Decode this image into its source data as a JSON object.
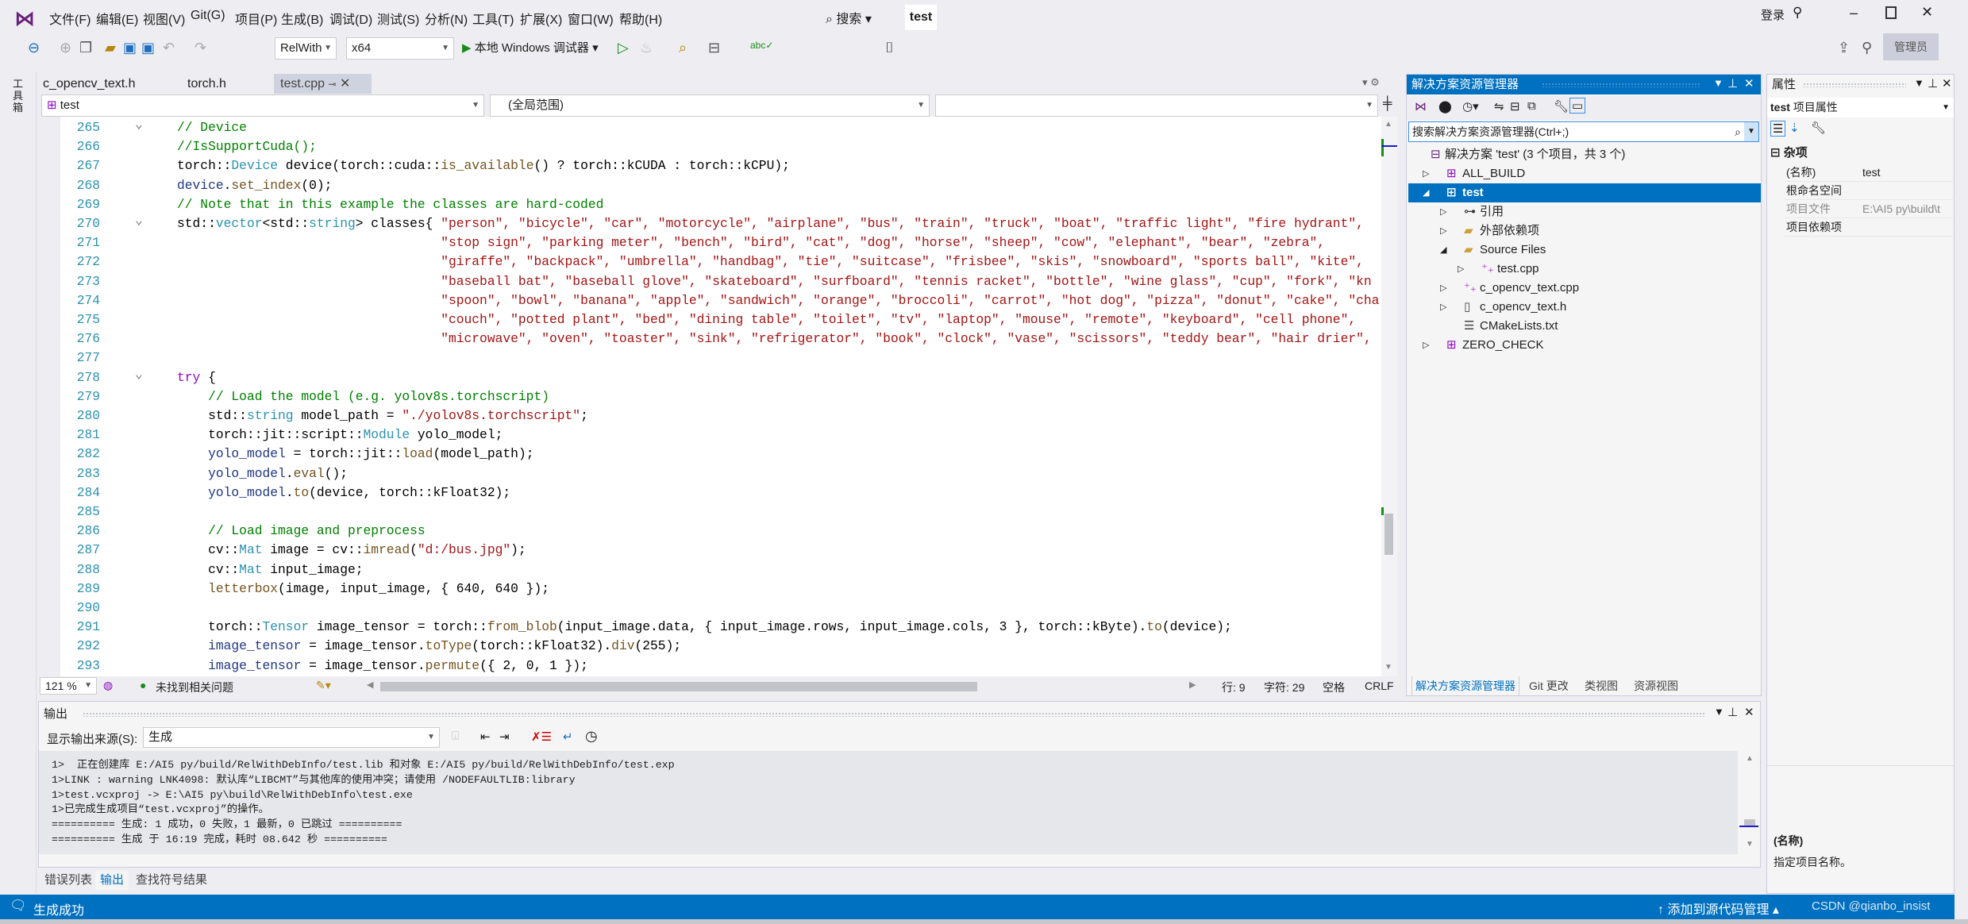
{
  "colors": {
    "accent": "#0070c0",
    "comment": "#008000",
    "type": "#2b91af",
    "string": "#a31515",
    "keyword": "#8f08c4"
  },
  "menubar": {
    "items": [
      "文件(F)",
      "编辑(E)",
      "视图(V)",
      "Git(G)",
      "项目(P)",
      "生成(B)",
      "调试(D)",
      "测试(S)",
      "分析(N)",
      "工具(T)",
      "扩展(X)",
      "窗口(W)",
      "帮助(H)"
    ],
    "search": "搜索",
    "solution_name": "test",
    "login": "登录",
    "admin": "管理员"
  },
  "toolbar": {
    "config": "RelWith",
    "platform": "x64",
    "run_label": "本地 Windows 调试器"
  },
  "toolbox_label": "工具箱",
  "tabs": [
    {
      "label": "c_opencv_text.h"
    },
    {
      "label": "torch.h"
    },
    {
      "label": "test.cpp"
    }
  ],
  "navbar": {
    "project": "test",
    "scope": "(全局范围)",
    "member": ""
  },
  "editor": {
    "lines": [
      {
        "num": "265",
        "tokens": [
          [
            "c",
            "// Device"
          ]
        ]
      },
      {
        "num": "266",
        "tokens": [
          [
            "c",
            "//IsSupportCuda();"
          ]
        ]
      },
      {
        "num": "267",
        "tokens": [
          [
            "p",
            "torch::"
          ],
          [
            "t",
            "Device"
          ],
          [
            "p",
            " device(torch::cuda::"
          ],
          [
            "f",
            "is_available"
          ],
          [
            "p",
            "() ? torch::kCUDA : torch::kCPU);"
          ]
        ]
      },
      {
        "num": "268",
        "tokens": [
          [
            "v",
            "device"
          ],
          [
            "p",
            "."
          ],
          [
            "f",
            "set_index"
          ],
          [
            "p",
            "(0);"
          ]
        ]
      },
      {
        "num": "269",
        "tokens": [
          [
            "c",
            "// Note that in this example the classes are hard-coded"
          ]
        ]
      },
      {
        "num": "270",
        "tokens": [
          [
            "p",
            "std::"
          ],
          [
            "t",
            "vector"
          ],
          [
            "p",
            "<std::"
          ],
          [
            "t",
            "string"
          ],
          [
            "p",
            "> classes{ "
          ],
          [
            "s",
            "\"person\", \"bicycle\", \"car\", \"motorcycle\", \"airplane\", \"bus\", \"train\", \"truck\", \"boat\", \"traffic light\", \"fire hydrant\","
          ]
        ]
      },
      {
        "num": "271",
        "tokens": [
          [
            "p",
            "                                  "
          ],
          [
            "s",
            "\"stop sign\", \"parking meter\", \"bench\", \"bird\", \"cat\", \"dog\", \"horse\", \"sheep\", \"cow\", \"elephant\", \"bear\", \"zebra\","
          ]
        ]
      },
      {
        "num": "272",
        "tokens": [
          [
            "p",
            "                                  "
          ],
          [
            "s",
            "\"giraffe\", \"backpack\", \"umbrella\", \"handbag\", \"tie\", \"suitcase\", \"frisbee\", \"skis\", \"snowboard\", \"sports ball\", \"kite\","
          ]
        ]
      },
      {
        "num": "273",
        "tokens": [
          [
            "p",
            "                                  "
          ],
          [
            "s",
            "\"baseball bat\", \"baseball glove\", \"skateboard\", \"surfboard\", \"tennis racket\", \"bottle\", \"wine glass\", \"cup\", \"fork\", \"kn"
          ]
        ]
      },
      {
        "num": "274",
        "tokens": [
          [
            "p",
            "                                  "
          ],
          [
            "s",
            "\"spoon\", \"bowl\", \"banana\", \"apple\", \"sandwich\", \"orange\", \"broccoli\", \"carrot\", \"hot dog\", \"pizza\", \"donut\", \"cake\", \"cha"
          ]
        ]
      },
      {
        "num": "275",
        "tokens": [
          [
            "p",
            "                                  "
          ],
          [
            "s",
            "\"couch\", \"potted plant\", \"bed\", \"dining table\", \"toilet\", \"tv\", \"laptop\", \"mouse\", \"remote\", \"keyboard\", \"cell phone\","
          ]
        ]
      },
      {
        "num": "276",
        "tokens": [
          [
            "p",
            "                                  "
          ],
          [
            "s",
            "\"microwave\", \"oven\", \"toaster\", \"sink\", \"refrigerator\", \"book\", \"clock\", \"vase\", \"scissors\", \"teddy bear\", \"hair drier\","
          ]
        ]
      },
      {
        "num": "277",
        "tokens": []
      },
      {
        "num": "278",
        "tokens": [
          [
            "k",
            "try"
          ],
          [
            "p",
            " {"
          ]
        ]
      },
      {
        "num": "279",
        "tokens": [
          [
            "p",
            "    "
          ],
          [
            "c",
            "// Load the model (e.g. yolov8s.torchscript)"
          ]
        ]
      },
      {
        "num": "280",
        "tokens": [
          [
            "p",
            "    std::"
          ],
          [
            "t",
            "string"
          ],
          [
            "p",
            " model_path = "
          ],
          [
            "s",
            "\"./yolov8s.torchscript\""
          ],
          [
            "p",
            ";"
          ]
        ]
      },
      {
        "num": "281",
        "tokens": [
          [
            "p",
            "    torch::jit::script::"
          ],
          [
            "t",
            "Module"
          ],
          [
            "p",
            " yolo_model;"
          ]
        ]
      },
      {
        "num": "282",
        "tokens": [
          [
            "p",
            "    "
          ],
          [
            "v",
            "yolo_model"
          ],
          [
            "p",
            " = torch::jit::"
          ],
          [
            "f",
            "load"
          ],
          [
            "p",
            "(model_path);"
          ]
        ]
      },
      {
        "num": "283",
        "tokens": [
          [
            "p",
            "    "
          ],
          [
            "v",
            "yolo_model"
          ],
          [
            "p",
            "."
          ],
          [
            "f",
            "eval"
          ],
          [
            "p",
            "();"
          ]
        ]
      },
      {
        "num": "284",
        "tokens": [
          [
            "p",
            "    "
          ],
          [
            "v",
            "yolo_model"
          ],
          [
            "p",
            "."
          ],
          [
            "f",
            "to"
          ],
          [
            "p",
            "(device, torch::kFloat32);"
          ]
        ]
      },
      {
        "num": "285",
        "tokens": []
      },
      {
        "num": "286",
        "tokens": [
          [
            "p",
            "    "
          ],
          [
            "c",
            "// Load image and preprocess"
          ]
        ]
      },
      {
        "num": "287",
        "tokens": [
          [
            "p",
            "    cv::"
          ],
          [
            "t",
            "Mat"
          ],
          [
            "p",
            " image = cv::"
          ],
          [
            "f",
            "imread"
          ],
          [
            "p",
            "("
          ],
          [
            "s",
            "\"d:/bus.jpg\""
          ],
          [
            "p",
            ");"
          ]
        ]
      },
      {
        "num": "288",
        "tokens": [
          [
            "p",
            "    cv::"
          ],
          [
            "t",
            "Mat"
          ],
          [
            "p",
            " input_image;"
          ]
        ]
      },
      {
        "num": "289",
        "tokens": [
          [
            "p",
            "    "
          ],
          [
            "f",
            "letterbox"
          ],
          [
            "p",
            "(image, input_image, { 640, 640 });"
          ]
        ]
      },
      {
        "num": "290",
        "tokens": []
      },
      {
        "num": "291",
        "tokens": [
          [
            "p",
            "    torch::"
          ],
          [
            "t",
            "Tensor"
          ],
          [
            "p",
            " image_tensor = torch::"
          ],
          [
            "f",
            "from_blob"
          ],
          [
            "p",
            "(input_image.data, { input_image.rows, input_image.cols, 3 }, torch::kByte)."
          ],
          [
            "f",
            "to"
          ],
          [
            "p",
            "(device);"
          ]
        ]
      },
      {
        "num": "292",
        "tokens": [
          [
            "p",
            "    "
          ],
          [
            "v",
            "image_tensor"
          ],
          [
            "p",
            " = image_tensor."
          ],
          [
            "f",
            "toType"
          ],
          [
            "p",
            "(torch::kFloat32)."
          ],
          [
            "f",
            "div"
          ],
          [
            "p",
            "(255);"
          ]
        ]
      },
      {
        "num": "293",
        "tokens": [
          [
            "p",
            "    "
          ],
          [
            "v",
            "image_tensor"
          ],
          [
            "p",
            " = image_tensor."
          ],
          [
            "f",
            "permute"
          ],
          [
            "p",
            "({ 2, 0, 1 });"
          ]
        ]
      }
    ]
  },
  "editor_status": {
    "zoom": "121 %",
    "issues": "未找到相关问题",
    "line": "行: 9",
    "char": "字符: 29",
    "spaces": "空格",
    "eol": "CRLF"
  },
  "solution_explorer": {
    "title": "解决方案资源管理器",
    "search_placeholder": "搜索解决方案资源管理器(Ctrl+;)",
    "tree": [
      {
        "label": "解决方案 'test' (3 个项目，共 3 个)",
        "level": 0,
        "icon": "solution-icon",
        "expander": ""
      },
      {
        "label": "ALL_BUILD",
        "level": 1,
        "icon": "project-icon",
        "expander": "collapsed"
      },
      {
        "label": "test",
        "level": 1,
        "icon": "project-icon",
        "expander": "expanded",
        "selected": true
      },
      {
        "label": "引用",
        "level": 2,
        "icon": "references-icon",
        "expander": "collapsed"
      },
      {
        "label": "外部依赖项",
        "level": 2,
        "icon": "folder-icon",
        "expander": "collapsed"
      },
      {
        "label": "Source Files",
        "level": 2,
        "icon": "filter-folder-icon",
        "expander": "expanded"
      },
      {
        "label": "test.cpp",
        "level": 3,
        "icon": "cpp-file-icon",
        "expander": "collapsed"
      },
      {
        "label": "c_opencv_text.cpp",
        "level": 2,
        "icon": "cpp-file-icon",
        "expander": "collapsed"
      },
      {
        "label": "c_opencv_text.h",
        "level": 2,
        "icon": "header-file-icon",
        "expander": "collapsed"
      },
      {
        "label": "CMakeLists.txt",
        "level": 2,
        "icon": "text-file-icon",
        "expander": ""
      },
      {
        "label": "ZERO_CHECK",
        "level": 1,
        "icon": "project-icon",
        "expander": "collapsed"
      }
    ],
    "bottom_tabs": [
      "解决方案资源管理器",
      "Git 更改",
      "类视图",
      "资源视图"
    ]
  },
  "properties": {
    "title": "属性",
    "object_name": "test",
    "object_type": "项目属性",
    "category": "杂项",
    "rows": [
      {
        "name": "(名称)",
        "value": "test"
      },
      {
        "name": "根命名空间",
        "value": ""
      },
      {
        "name": "项目文件",
        "value": "E:\\AI5 py\\build\\t"
      },
      {
        "name": "项目依赖项",
        "value": ""
      }
    ],
    "desc_title": "(名称)",
    "desc_text": "指定项目名称。"
  },
  "output": {
    "title": "输出",
    "source_label": "显示输出来源(S):",
    "source_value": "生成",
    "lines": [
      "1>  正在创建库 E:/AI5 py/build/RelWithDebInfo/test.lib 和对象 E:/AI5 py/build/RelWithDebInfo/test.exp",
      "1>LINK : warning LNK4098: 默认库“LIBCMT”与其他库的使用冲突；请使用 /NODEFAULTLIB:library",
      "1>test.vcxproj -> E:\\AI5 py\\build\\RelWithDebInfo\\test.exe",
      "1>已完成生成项目“test.vcxproj”的操作。",
      "========== 生成: 1 成功，0 失败，1 最新，0 已跳过 ==========",
      "========== 生成 于 16:19 完成，耗时 08.642 秒 =========="
    ]
  },
  "bottom_tabs": [
    "错误列表",
    "输出",
    "查找符号结果"
  ],
  "statusbar": {
    "message": "生成成功",
    "source_control": "添加到源代码管理",
    "watermark": "CSDN @qianbo_insist"
  }
}
